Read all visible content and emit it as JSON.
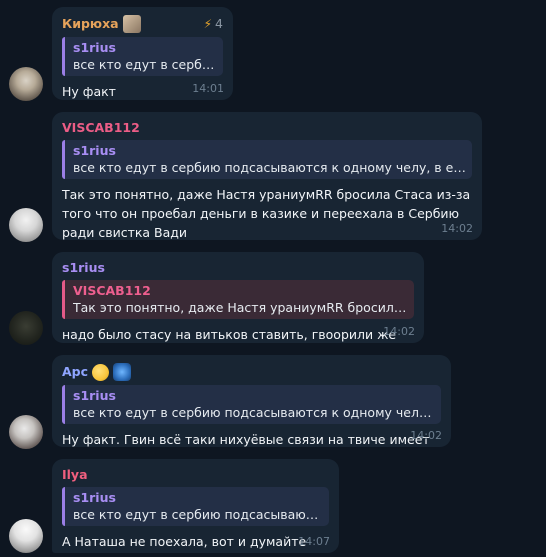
{
  "colors": {
    "background": "#0e1621",
    "bubble": "#182533",
    "name_kiryuha": "#e6a35b",
    "name_viscab": "#ec5d86",
    "name_s1rius": "#a88ef3",
    "name_apc": "#8fa5ff",
    "name_ilya": "#ef5f7f"
  },
  "messages": [
    {
      "sender": "Кирюха",
      "boost_count": "4",
      "reply_name": "s1rius",
      "reply_text": "все кто едут в сербию…",
      "text": "Ну факт",
      "time": "14:01"
    },
    {
      "sender": "VISCAB112",
      "reply_name": "s1rius",
      "reply_text": "все кто едут в сербию подсасываются к одному челу, в его св…",
      "text": "Так это понятно, даже Настя ураниумRR бросила Стаса  из-за того что он проебал деньги в казике и переехала в Сербию ради свистка Вади",
      "time": "14:02"
    },
    {
      "sender": "s1rius",
      "reply_name": "VISCAB112",
      "reply_text": "Так это понятно, даже Настя ураниумRR бросила Ст…",
      "text": "надо было стасу на витьков ставить, гвоорили же",
      "time": "14:02"
    },
    {
      "sender": "Apc",
      "reply_name": "s1rius",
      "reply_text": "все кто едут в сербию подсасываются к одному челу, в е…",
      "text": "Ну факт. Гвин всё таки нихуёвые связи на твиче имеет",
      "time": "14:02"
    },
    {
      "sender": "Ilya",
      "reply_name": "s1rius",
      "reply_text": "все кто едут в сербию подсасываются …",
      "text": "А Наташа не поехала, вот и думайте",
      "time": "14:07"
    }
  ]
}
